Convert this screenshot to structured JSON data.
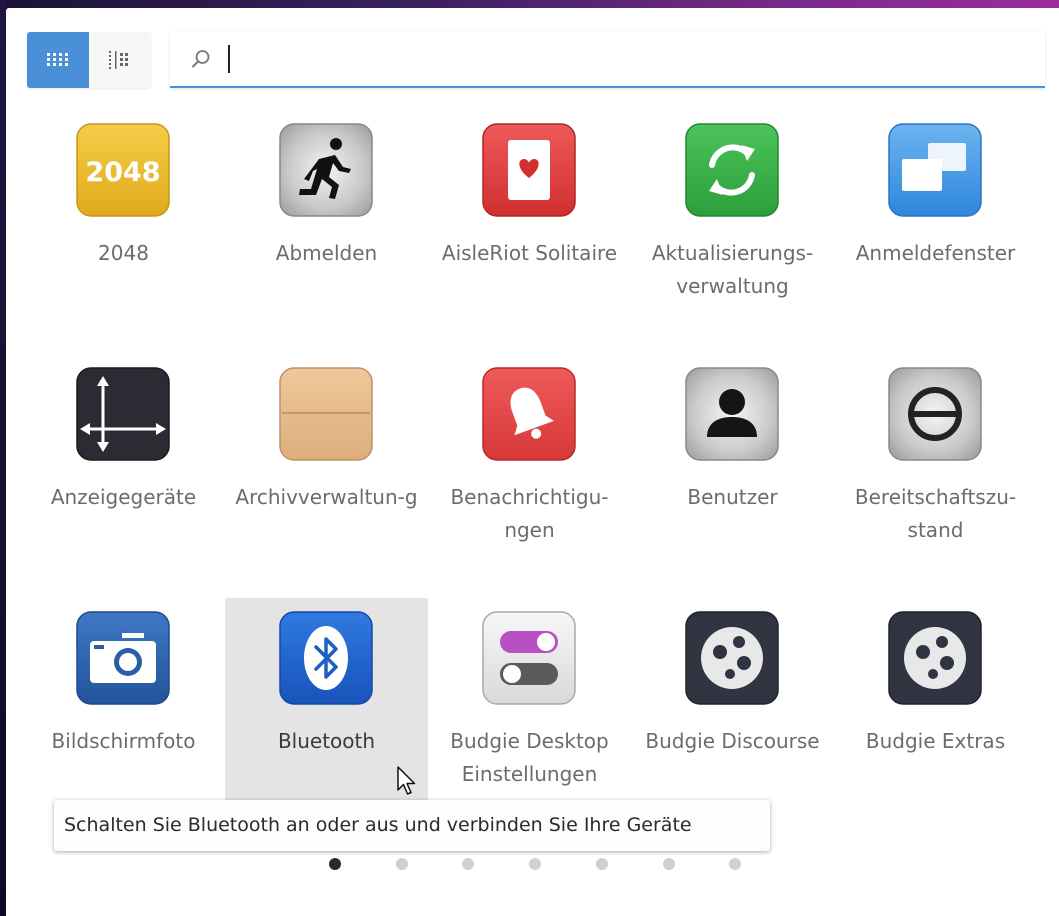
{
  "view_modes": [
    {
      "name": "grid",
      "active": true
    },
    {
      "name": "category",
      "active": false
    }
  ],
  "search": {
    "value": "",
    "placeholder": ""
  },
  "apps": [
    {
      "label": "2048",
      "icon": "game-2048-icon",
      "badge_text": "2048"
    },
    {
      "label": "Abmelden",
      "icon": "running-man-icon"
    },
    {
      "label": "AisleRiot Solitaire",
      "icon": "playing-card-heart-icon"
    },
    {
      "label": "Aktualisierungs-verwaltung",
      "icon": "refresh-arrows-icon"
    },
    {
      "label": "Anmeldefenster",
      "icon": "overlapping-windows-icon"
    },
    {
      "label": "Anzeigegeräte",
      "icon": "display-arrows-icon"
    },
    {
      "label": "Archivverwaltun-g",
      "icon": "archive-box-icon"
    },
    {
      "label": "Benachrichtigu-ngen",
      "icon": "bell-icon"
    },
    {
      "label": "Benutzer",
      "icon": "user-silhouette-icon"
    },
    {
      "label": "Bereitschaftszu-stand",
      "icon": "standby-circle-icon"
    },
    {
      "label": "Bildschirmfoto",
      "icon": "camera-icon"
    },
    {
      "label": "Bluetooth",
      "icon": "bluetooth-icon",
      "selected": true
    },
    {
      "label": "Budgie Desktop Einstellungen",
      "icon": "toggle-switches-icon"
    },
    {
      "label": "Budgie Discourse",
      "icon": "budgie-logo-icon"
    },
    {
      "label": "Budgie Extras",
      "icon": "budgie-logo-icon"
    }
  ],
  "tooltip": "Schalten Sie Bluetooth an oder aus und verbinden Sie Ihre Geräte",
  "pagination": {
    "pages": 7,
    "current": 1
  },
  "colors": {
    "accent": "#4a90d9",
    "label": "#6c6c6c",
    "selected_bg": "#e4e4e4"
  }
}
